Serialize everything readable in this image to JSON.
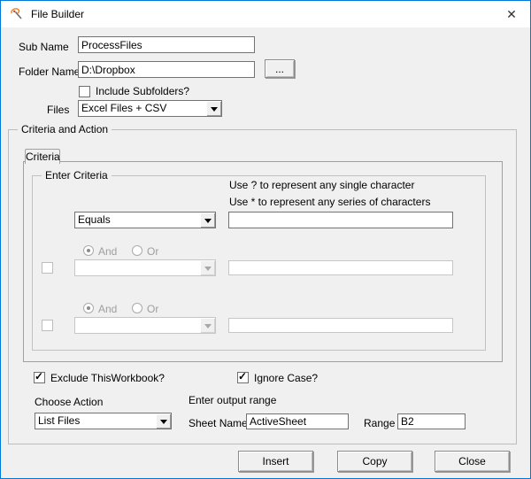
{
  "window": {
    "title": "File Builder",
    "close_glyph": "✕"
  },
  "form": {
    "sub_name_label": "Sub Name",
    "sub_name_value": "ProcessFiles",
    "folder_label": "Folder Name",
    "folder_value": "D:\\Dropbox",
    "browse_label": "...",
    "include_subfolders_label": "Include Subfolders?",
    "include_subfolders_checked": false,
    "files_label": "Files",
    "files_value": "Excel Files + CSV"
  },
  "criteria": {
    "group_label": "Criteria and Action",
    "tab_label": "Criteria",
    "enter_group_label": "Enter Criteria",
    "hint1": "Use ? to represent any single character",
    "hint2": "Use * to represent any series of characters",
    "row1_operator": "Equals",
    "row1_value": "",
    "and_label": "And",
    "or_label": "Or",
    "row2_operator": "",
    "row2_value": "",
    "row3_operator": "",
    "row3_value": ""
  },
  "options": {
    "exclude_label": "Exclude ThisWorkbook?",
    "exclude_checked": true,
    "ignore_case_label": "Ignore Case?",
    "ignore_case_checked": true,
    "check_glyph": "✓"
  },
  "action": {
    "choose_label": "Choose Action",
    "action_value": "List Files",
    "output_range_label": "Enter output range",
    "sheet_label": "Sheet Name",
    "sheet_value": "ActiveSheet",
    "range_label": "Range",
    "range_value": "B2"
  },
  "buttons": {
    "insert": "Insert",
    "copy": "Copy",
    "close": "Close"
  },
  "colors": {
    "accent_border": "#0078d7",
    "titlebar_bg": "#ffffff",
    "dialog_bg": "#f0f0f0"
  }
}
